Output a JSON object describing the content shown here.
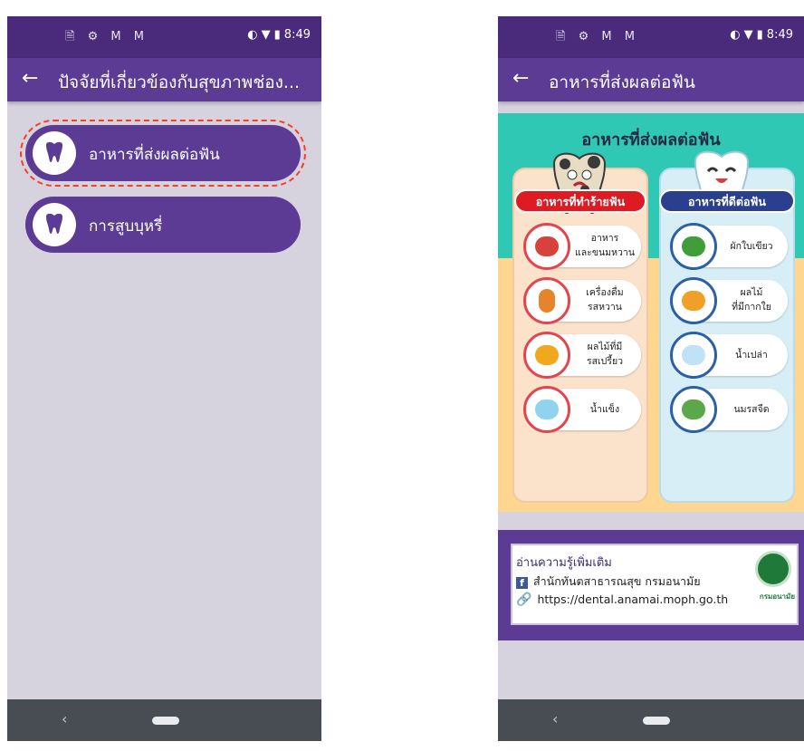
{
  "colors": {
    "status_bar": "#4a2a7a",
    "app_bar": "#5b3b94",
    "background": "#d6d2de",
    "nav_bar": "#474d52",
    "highlight": "#ff3b1f",
    "bad_pill": "#de1a22",
    "good_pill": "#2b3f8f"
  },
  "status": {
    "left_icons": "🗎 ⚙ M M",
    "time": "8:49"
  },
  "left_screen": {
    "title": "ปัจจัยที่เกี่ยวข้องกับสุขภาพช่อง...",
    "menu": [
      {
        "label": "อาหารที่ส่งผลต่อฟัน",
        "icon": "tooth-icon",
        "highlighted": true
      },
      {
        "label": "การสูบบุหรี่",
        "icon": "tooth-icon",
        "highlighted": false
      }
    ]
  },
  "right_screen": {
    "title": "อาหารที่ส่งผลต่อฟัน",
    "poster": {
      "title": "อาหารที่ส่งผลต่อฟัน",
      "bad_header": "อาหารที่ทำร้ายฟัน",
      "good_header": "อาหารที่ดีต่อฟัน",
      "bad_items": [
        {
          "line1": "อาหาร",
          "line2": "และขนมหวาน"
        },
        {
          "line1": "เครื่องดื่ม",
          "line2": "รสหวาน"
        },
        {
          "line1": "ผลไม้ที่มี",
          "line2": "รสเปรี้ยว"
        },
        {
          "line1": "น้ำแข็ง",
          "line2": ""
        }
      ],
      "good_items": [
        {
          "line1": "ผักใบเขียว",
          "line2": ""
        },
        {
          "line1": "ผลไม้",
          "line2": "ที่มีกากใย"
        },
        {
          "line1": "น้ำเปล่า",
          "line2": ""
        },
        {
          "line1": "นมรสจืด",
          "line2": ""
        }
      ]
    },
    "source": {
      "heading": "อ่านความรู้เพิ่มเติม",
      "facebook": "สำนักทันตสาธารณสุข กรมอนามัย",
      "link": "https://dental.anamai.moph.go.th",
      "seal_label": "กรมอนามัย"
    }
  }
}
